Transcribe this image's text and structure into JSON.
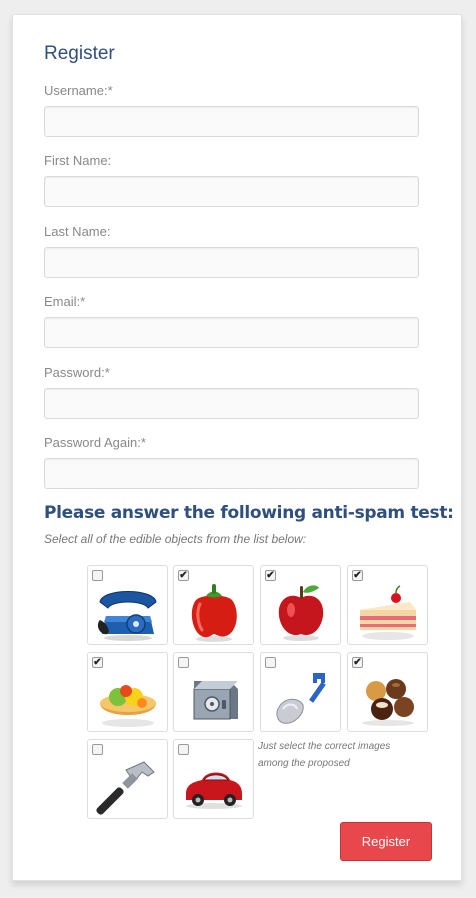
{
  "form": {
    "title": "Register",
    "fields": [
      {
        "label": "Username:*",
        "value": ""
      },
      {
        "label": "First Name:",
        "value": ""
      },
      {
        "label": "Last Name:",
        "value": ""
      },
      {
        "label": "Email:*",
        "value": ""
      },
      {
        "label": "Password:*",
        "value": ""
      },
      {
        "label": "Password Again:*",
        "value": ""
      }
    ]
  },
  "antispam": {
    "heading": "Please answer the following anti-spam test:",
    "instruction": "Select all of the edible objects from the list below:",
    "hint": "Just select the correct images among the proposed",
    "items": [
      {
        "icon": "telephone-icon",
        "checked": false
      },
      {
        "icon": "red-pepper-icon",
        "checked": true
      },
      {
        "icon": "apple-icon",
        "checked": true
      },
      {
        "icon": "cake-slice-icon",
        "checked": true
      },
      {
        "icon": "fruit-tart-icon",
        "checked": true
      },
      {
        "icon": "safe-icon",
        "checked": false
      },
      {
        "icon": "shovel-icon",
        "checked": false
      },
      {
        "icon": "chocolates-icon",
        "checked": true
      },
      {
        "icon": "hammer-icon",
        "checked": false
      },
      {
        "icon": "red-car-icon",
        "checked": false
      }
    ]
  },
  "submit": {
    "label": "Register",
    "color": "#e8484c"
  }
}
